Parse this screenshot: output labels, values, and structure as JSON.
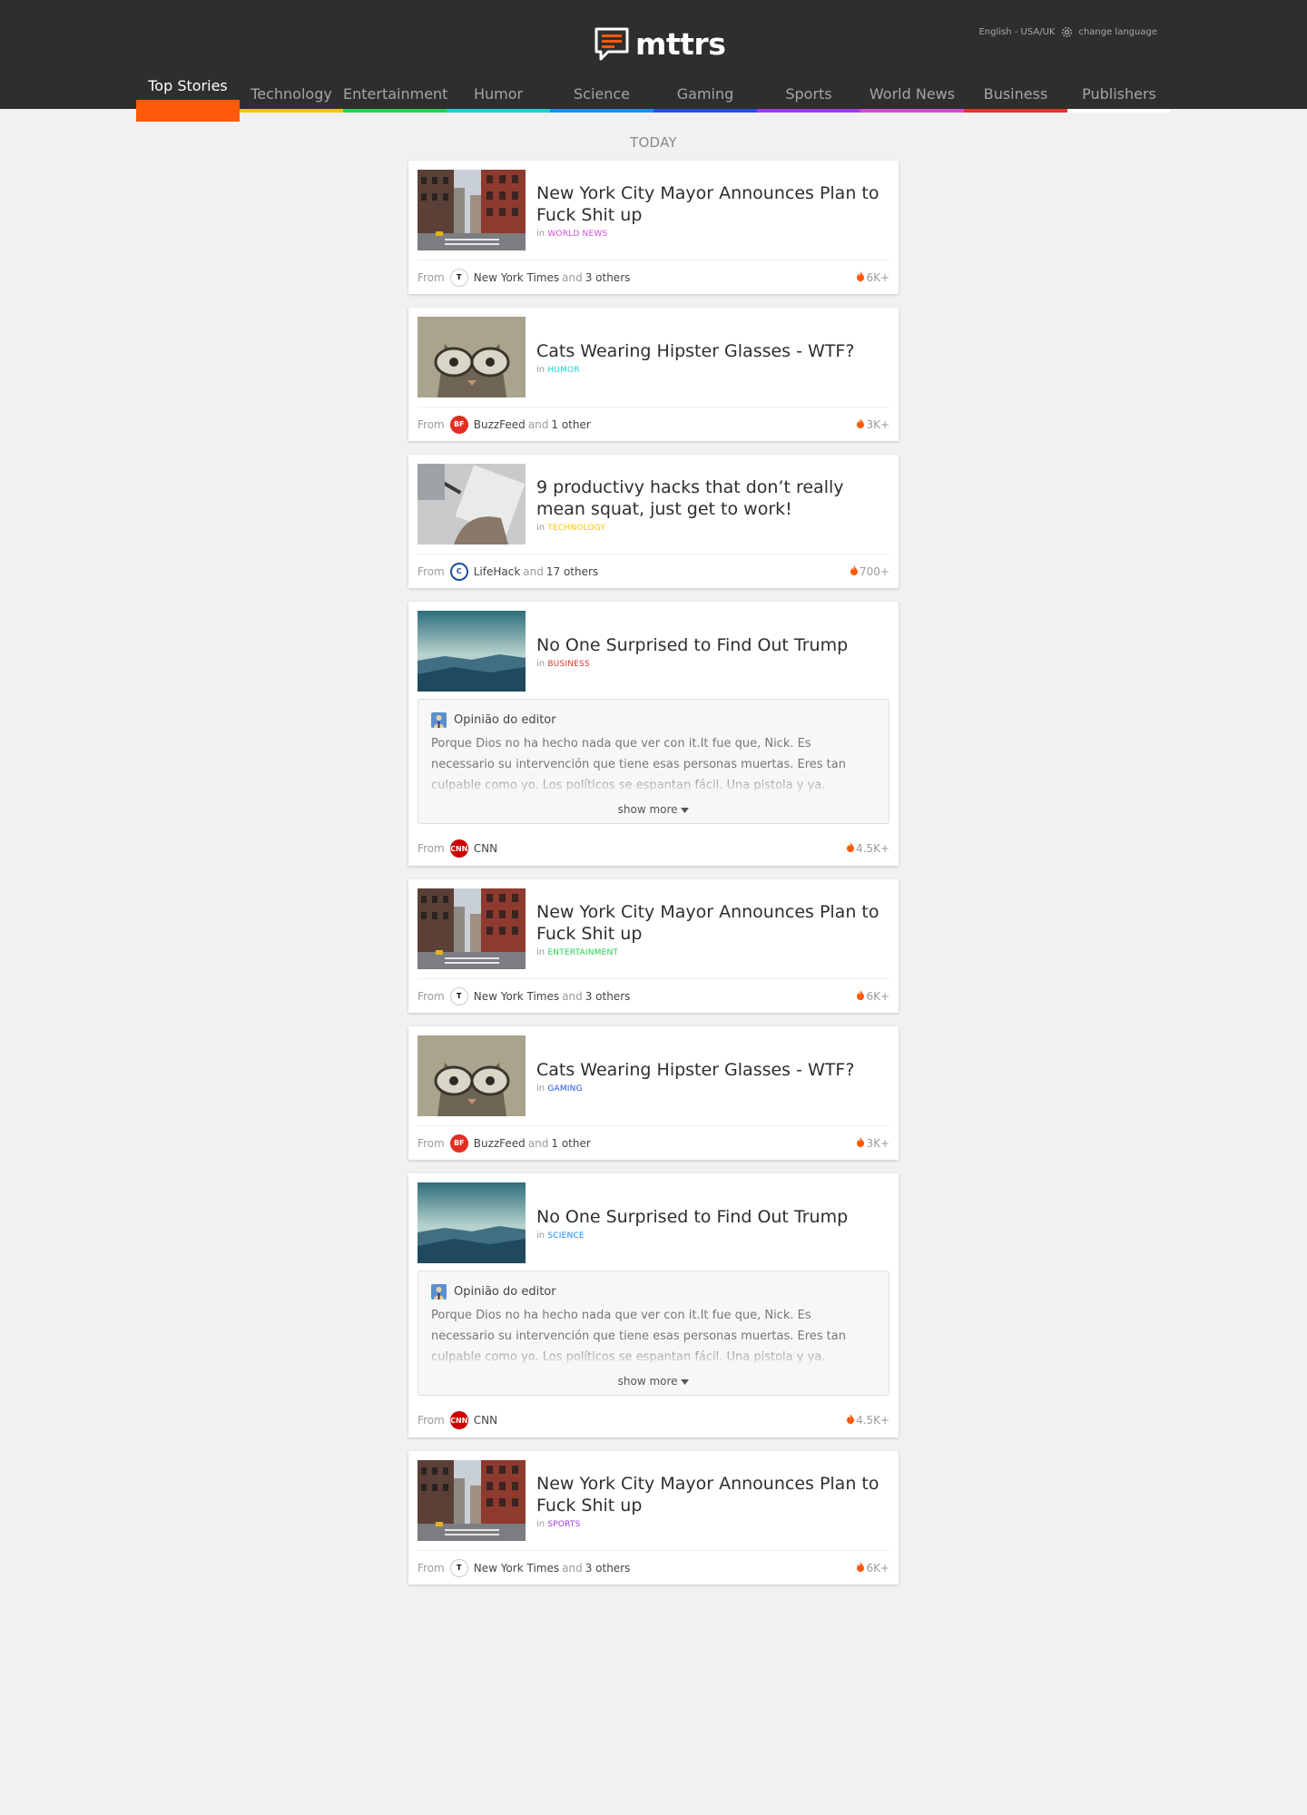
{
  "header": {
    "brand": "mttrs",
    "language": "English - USA/UK",
    "change_language": "change language"
  },
  "nav": [
    {
      "label": "Top Stories",
      "color": "#ff5a0a",
      "active": true
    },
    {
      "label": "Technology",
      "color": "#f5c400"
    },
    {
      "label": "Entertainment",
      "color": "#22d251"
    },
    {
      "label": "Humor",
      "color": "#18d1d0"
    },
    {
      "label": "Science",
      "color": "#1a8cf0"
    },
    {
      "label": "Gaming",
      "color": "#2450e0"
    },
    {
      "label": "Sports",
      "color": "#a339e6"
    },
    {
      "label": "World News",
      "color": "#d24ad6"
    },
    {
      "label": "Business",
      "color": "#e2352b"
    },
    {
      "label": "Publishers",
      "color": "#ffffff"
    }
  ],
  "section_label": "TODAY",
  "cards": [
    {
      "title": "New York City Mayor Announces Plan to Fuck Shit up",
      "in": "in",
      "category": "WORLD NEWS",
      "category_color": "#d24ad6",
      "thumb": "street-photo",
      "from": "From",
      "publisher": "New York Times",
      "publisher_logo": "nyt-logo",
      "and": "and",
      "others": "3 others",
      "count": "6K+"
    },
    {
      "title": "Cats Wearing Hipster Glasses - WTF?",
      "in": "in",
      "category": "HUMOR",
      "category_color": "#18d1d0",
      "thumb": "cat-photo",
      "from": "From",
      "publisher": "BuzzFeed",
      "publisher_logo": "buzzfeed-logo",
      "and": "and",
      "others": "1 other",
      "count": "3K+"
    },
    {
      "title": "9 productivy hacks that don’t really mean squat, just get to work!",
      "in": "in",
      "category": "TECHNOLOGY",
      "category_color": "#f5c400",
      "thumb": "desk-photo",
      "from": "From",
      "publisher": "LifeHack",
      "publisher_logo": "lifehack-logo",
      "and": "and",
      "others": "17 others",
      "count": "700+"
    },
    {
      "title": "No One Surprised to Find Out Trump",
      "in": "in",
      "category": "BUSINESS",
      "category_color": "#e2352b",
      "thumb": "landscape-photo",
      "editor": {
        "heading": "Opinião do editor",
        "body": "Porque Dios no ha hecho nada que ver con it.It fue que, Nick. Es necessario su intervención que tiene esas personas muertas. Eres tan culpable como yo. Los políticos se espantan fácil. Una pistola y ya.",
        "show_more": "show more"
      },
      "from": "From",
      "publisher": "CNN",
      "publisher_logo": "cnn-logo",
      "count": "4.5K+"
    },
    {
      "title": "New York City Mayor Announces Plan to Fuck Shit up",
      "in": "in",
      "category": "ENTERTAINMENT",
      "category_color": "#22d251",
      "thumb": "street-photo",
      "from": "From",
      "publisher": "New York Times",
      "publisher_logo": "nyt-logo",
      "and": "and",
      "others": "3 others",
      "count": "6K+"
    },
    {
      "title": "Cats Wearing Hipster Glasses - WTF?",
      "in": "in",
      "category": "GAMING",
      "category_color": "#2450e0",
      "thumb": "cat-photo",
      "from": "From",
      "publisher": "BuzzFeed",
      "publisher_logo": "buzzfeed-logo",
      "and": "and",
      "others": "1 other",
      "count": "3K+"
    },
    {
      "title": "No One Surprised to Find Out Trump",
      "in": "in",
      "category": "SCIENCE",
      "category_color": "#1a8cf0",
      "thumb": "landscape-photo",
      "editor": {
        "heading": "Opinião do editor",
        "body": "Porque Dios no ha hecho nada que ver con it.It fue que, Nick. Es necessario su intervención que tiene esas personas muertas. Eres tan culpable como yo. Los políticos se espantan fácil. Una pistola y ya.",
        "show_more": "show more"
      },
      "from": "From",
      "publisher": "CNN",
      "publisher_logo": "cnn-logo",
      "count": "4.5K+"
    },
    {
      "title": "New York City Mayor Announces Plan to Fuck Shit up",
      "in": "in",
      "category": "SPORTS",
      "category_color": "#a339e6",
      "thumb": "street-photo",
      "from": "From",
      "publisher": "New York Times",
      "publisher_logo": "nyt-logo",
      "and": "and",
      "others": "3 others",
      "count": "6K+"
    }
  ]
}
